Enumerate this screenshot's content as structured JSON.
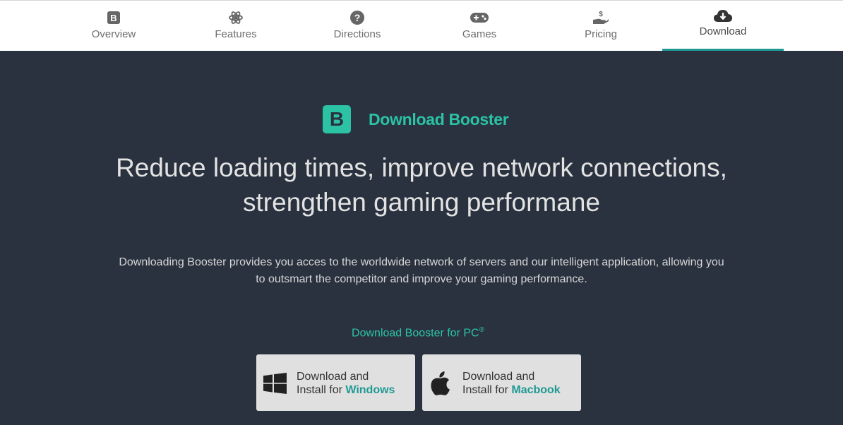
{
  "nav": {
    "tabs": [
      {
        "label": "Overview",
        "icon": "bootstrap-icon"
      },
      {
        "label": "Features",
        "icon": "atom-icon"
      },
      {
        "label": "Directions",
        "icon": "question-circle-icon"
      },
      {
        "label": "Games",
        "icon": "gamepad-icon"
      },
      {
        "label": "Pricing",
        "icon": "hand-dollar-icon"
      },
      {
        "label": "Download",
        "icon": "cloud-download-icon"
      }
    ],
    "active": "Download"
  },
  "hero": {
    "logo_letter": "B",
    "brand_title": "Download Booster",
    "headline_line1": "Reduce loading times, improve network connections,",
    "headline_line2": "strengthen gaming performane",
    "description_line1": "Downloading Booster provides you acces to the worldwide network of servers and our intelligent application, allowing you",
    "description_line2": "to outsmart the competitor and improve your gaming performance.",
    "pc_label": "Download Booster for PC",
    "pc_label_mark": "®"
  },
  "downloads": {
    "windows": {
      "line1": "Download and",
      "line2_prefix": "Install for ",
      "os": "Windows"
    },
    "mac": {
      "line1": "Download and",
      "line2_prefix": "Install for ",
      "os": "Macbook"
    }
  },
  "colors": {
    "accent": "#2bc3a4",
    "accent_dark": "#1f9a93",
    "background": "#2a323f",
    "topbar": "#ffffff",
    "button": "#e0e0e0"
  }
}
